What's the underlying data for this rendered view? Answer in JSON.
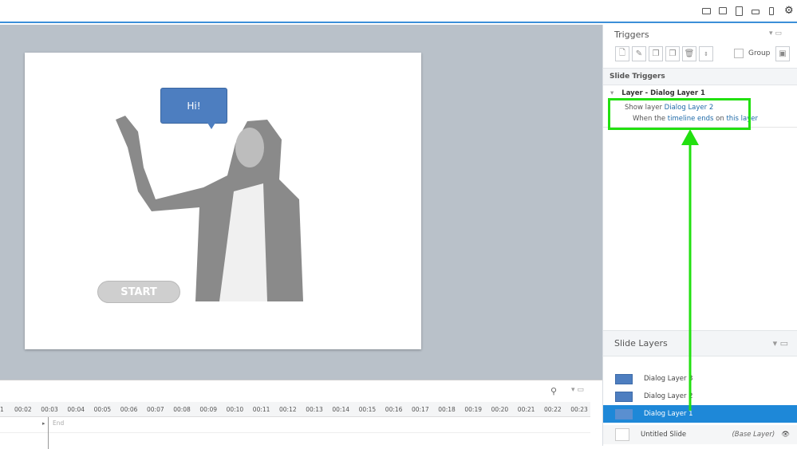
{
  "topbar": {
    "icons": [
      "laptop-icon",
      "monitor-icon",
      "tablet-portrait-icon",
      "tablet-landscape-icon",
      "phone-icon",
      "gear-icon"
    ]
  },
  "slide": {
    "bubble_text": "Hi!",
    "start_label": "START"
  },
  "triggers": {
    "title": "Triggers",
    "group_label": "Group",
    "section_title": "Slide Triggers",
    "group_title": "Layer - Dialog Layer 1",
    "action_prefix": "Show layer",
    "action_target": "Dialog Layer 2",
    "condition_prefix": "When the",
    "condition_event": "timeline ends",
    "condition_mid": "on",
    "condition_object": "this layer"
  },
  "layers": {
    "title": "Slide Layers",
    "items": [
      {
        "label": "Dialog Layer 3"
      },
      {
        "label": "Dialog Layer 2"
      },
      {
        "label": "Dialog Layer 1",
        "selected": true
      }
    ],
    "base": {
      "label": "Untitled Slide",
      "tag": "(Base Layer)"
    }
  },
  "timeline": {
    "ticks": [
      "1",
      "00:02",
      "00:03",
      "00:04",
      "00:05",
      "00:06",
      "00:07",
      "00:08",
      "00:09",
      "00:10",
      "00:11",
      "00:12",
      "00:13",
      "00:14",
      "00:15",
      "00:16",
      "00:17",
      "00:18",
      "00:19",
      "00:20",
      "00:21",
      "00:22",
      "00:23"
    ],
    "end_label": "End"
  },
  "colors": {
    "accent": "#1e88d8",
    "annotation": "#22e010",
    "bubble": "#4d7ec0"
  }
}
